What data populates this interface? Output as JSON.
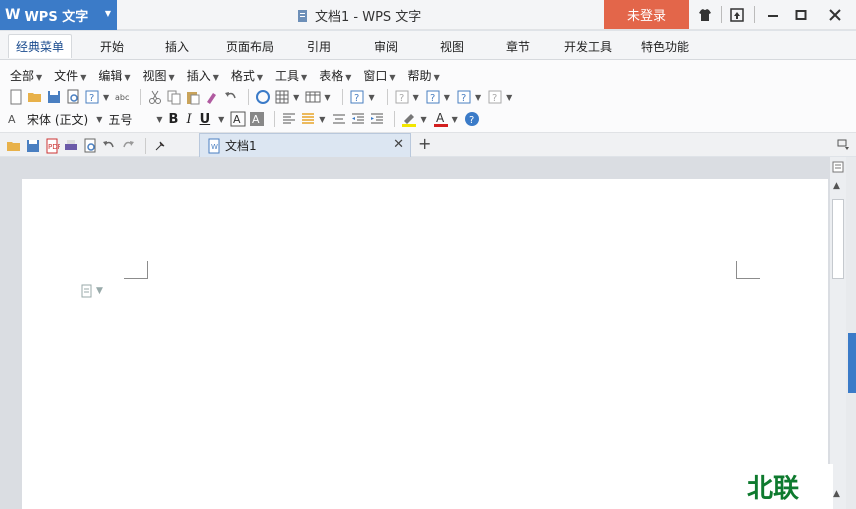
{
  "title_bar": {
    "app_name": "WPS 文字",
    "app_logo": "W",
    "doc_title": "文档1 - WPS 文字",
    "login_label": "未登录"
  },
  "tabs": [
    {
      "label": "经典菜单",
      "active": true
    },
    {
      "label": "开始"
    },
    {
      "label": "插入"
    },
    {
      "label": "页面布局"
    },
    {
      "label": "引用"
    },
    {
      "label": "审阅"
    },
    {
      "label": "视图"
    },
    {
      "label": "章节"
    },
    {
      "label": "开发工具"
    },
    {
      "label": "特色功能"
    }
  ],
  "menu_bar": [
    "全部",
    "文件",
    "编辑",
    "视图",
    "插入",
    "格式",
    "工具",
    "表格",
    "窗口",
    "帮助"
  ],
  "format_bar": {
    "font_name": "宋体 (正文)",
    "font_size": "五号",
    "bold": "B",
    "italic": "I",
    "underline": "U"
  },
  "document_tab": {
    "name": "文档1"
  },
  "watermark_text": "北联",
  "colors": {
    "app_button": "#3b7bc8",
    "login_button": "#e3664a",
    "watermark": "#0e7a2e"
  }
}
